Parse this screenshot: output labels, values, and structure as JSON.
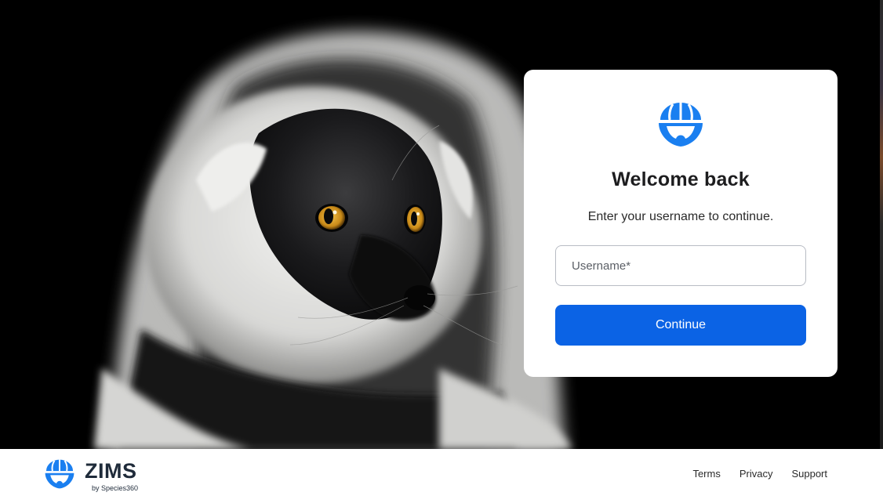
{
  "login": {
    "title": "Welcome back",
    "subtitle": "Enter your username to continue.",
    "username_placeholder": "Username*",
    "username_value": "",
    "continue_label": "Continue"
  },
  "footer": {
    "brand_name": "ZIMS",
    "brand_sub": "by Species360",
    "links": [
      "Terms",
      "Privacy",
      "Support"
    ]
  },
  "hero": {
    "image_subject": "black-and-white ruffed lemur"
  },
  "colors": {
    "primary": "#0b63e5",
    "logo": "#1a7ff0",
    "brand_text": "#1f2b3a",
    "card_bg": "#ffffff",
    "page_bg": "#000000"
  },
  "icons": {
    "card_logo": "species360-globe-icon",
    "footer_logo": "zims-globe-icon"
  }
}
